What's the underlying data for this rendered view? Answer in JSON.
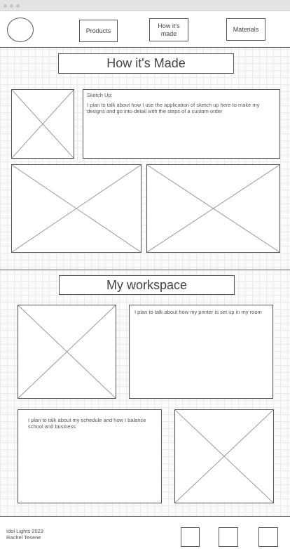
{
  "nav": {
    "logo_icon": "circle-logo-icon",
    "items": [
      "Products",
      "How it's made",
      "Materials"
    ]
  },
  "how_section": {
    "title": "How it's Made",
    "sketch_heading": "Sketch Up:",
    "sketch_text": "I plan to talk about how I use the application of sketch up here to make my designs and go into detail with the steps of a custom order",
    "placeholder_icon": "image-placeholder-icon"
  },
  "workspace_section": {
    "title": "My workspace",
    "printer_text": "I plan to talk about how my printer is set up in my room",
    "schedule_text": "I plan to talk about my schedule and how I balance school and business",
    "placeholder_icon": "image-placeholder-icon"
  },
  "footer": {
    "line1": "Idol Lights 2023",
    "line2": "Rachel Tesene",
    "social_icons": [
      "social-icon-1",
      "social-icon-2",
      "social-icon-3"
    ]
  }
}
